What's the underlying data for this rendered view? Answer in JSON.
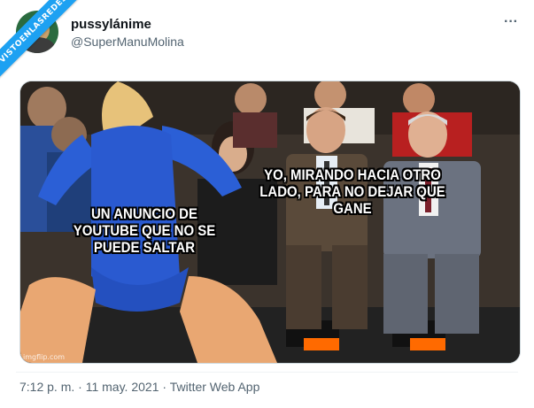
{
  "ribbon": {
    "text": "VISTOENLASREDES"
  },
  "user": {
    "name": "pussylánime",
    "handle": "@SuperManuMolina"
  },
  "more_icon": "more-horizontal-icon",
  "media": {
    "caption_left": "UN ANUNCIO DE YOUTUBE QUE NO SE PUEDE SALTAR",
    "caption_right": "YO, MIRANDO HACIA OTRO LADO, PARA NO DEJAR QUE GANE",
    "watermark": "imgflip.com"
  },
  "meta": {
    "time": "7:12 p. m.",
    "sep1": " · ",
    "date": "11 may. 2021",
    "sep2": " · ",
    "source": "Twitter Web App"
  },
  "colors": {
    "accent": "#1da1f2",
    "text": "#0f1419",
    "muted": "#536471"
  }
}
